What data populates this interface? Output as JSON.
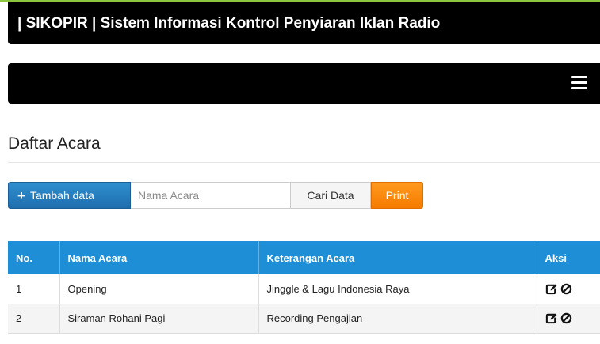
{
  "header": {
    "title": "| SIKOPIR | Sistem Informasi Kontrol Penyiaran Iklan Radio"
  },
  "nav": {
    "menu_icon": "hamburger-menu-icon"
  },
  "page": {
    "title": "Daftar Acara"
  },
  "toolbar": {
    "add_label": "Tambah data",
    "add_icon": "plus-icon",
    "search_placeholder": "Nama Acara",
    "search_value": "",
    "search_button_label": "Cari Data",
    "print_label": "Print"
  },
  "table": {
    "headers": {
      "no": "No.",
      "nama": "Nama Acara",
      "keterangan": "Keterangan Acara",
      "aksi": "Aksi"
    },
    "rows": [
      {
        "no": "1",
        "nama": "Opening",
        "keterangan": "Jinggle & Lagu Indonesia Raya",
        "actions": [
          "edit-icon",
          "delete-icon"
        ]
      },
      {
        "no": "2",
        "nama": "Siraman Rohani Pagi",
        "keterangan": "Recording Pengajian",
        "actions": [
          "edit-icon",
          "delete-icon"
        ]
      }
    ]
  },
  "colors": {
    "header_bg": "#000000",
    "accent_top": "#8cc63f",
    "primary": "#1e8fd6",
    "print": "#f57b00"
  }
}
